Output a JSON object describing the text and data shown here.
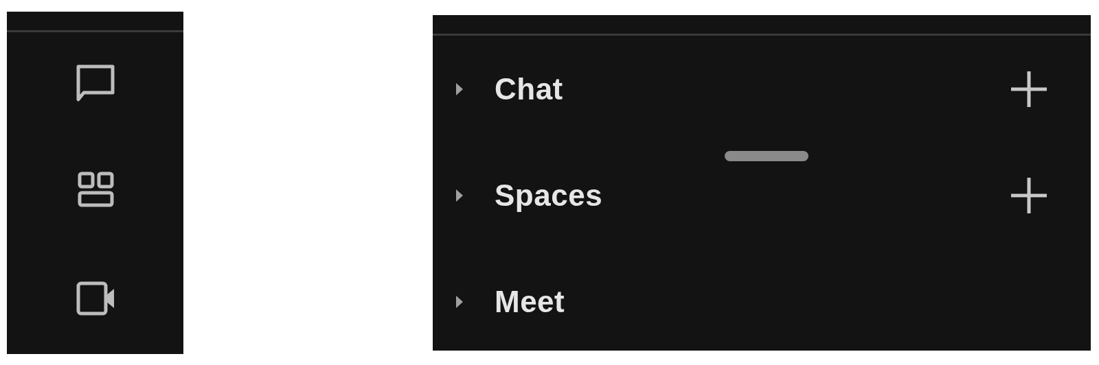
{
  "rail": [
    {
      "kind": "chat"
    },
    {
      "kind": "spaces"
    },
    {
      "kind": "video"
    }
  ],
  "sections": [
    {
      "label": "Chat",
      "expanded": false,
      "add_button": true
    },
    {
      "label": "Spaces",
      "expanded": false,
      "add_button": true
    },
    {
      "label": "Meet",
      "expanded": false,
      "add_button": false
    }
  ]
}
